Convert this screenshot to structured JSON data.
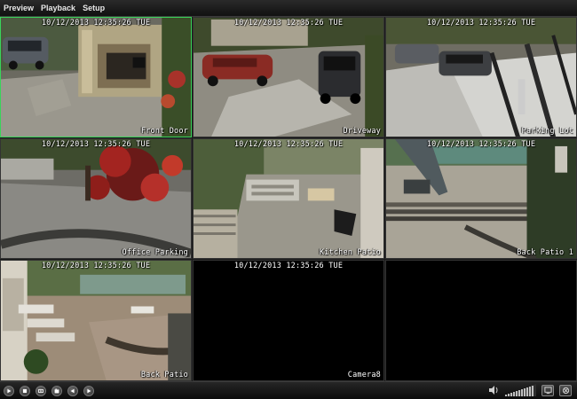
{
  "menu": {
    "items": [
      "Preview",
      "Playback",
      "Setup"
    ]
  },
  "cameras": [
    {
      "timestamp": "10/12/2013 12:35:26 TUE",
      "name": "Front Door",
      "selected": true
    },
    {
      "timestamp": "10/12/2013 12:35:26 TUE",
      "name": "Driveway",
      "selected": false
    },
    {
      "timestamp": "10/12/2013 12:35:26 TUE",
      "name": "Parking Lot",
      "selected": false
    },
    {
      "timestamp": "10/12/2013 12:35:26 TUE",
      "name": "Office Parking",
      "selected": false
    },
    {
      "timestamp": "10/12/2013 12:35:26 TUE",
      "name": "Kitchen Patio",
      "selected": false
    },
    {
      "timestamp": "10/12/2013 12:35:26 TUE",
      "name": "Back Patio 1",
      "selected": false
    },
    {
      "timestamp": "10/12/2013 12:35:26 TUE",
      "name": "Back Patio",
      "selected": false
    },
    {
      "timestamp": "10/12/2013 12:35:26 TUE",
      "name": "Camera8",
      "selected": false
    },
    {
      "timestamp": "",
      "name": "",
      "selected": false
    }
  ],
  "toolbar": {
    "buttons": [
      "play-icon",
      "stop-icon",
      "record-icon",
      "snapshot-icon",
      "previous-icon",
      "next-icon"
    ],
    "right_icons": [
      "speaker-icon",
      "volume-level-icon",
      "layout-icon",
      "fullscreen-icon"
    ]
  },
  "colors": {
    "selected_border": "#39d45a",
    "overlay_text": "#ffffff",
    "background": "#000000"
  }
}
